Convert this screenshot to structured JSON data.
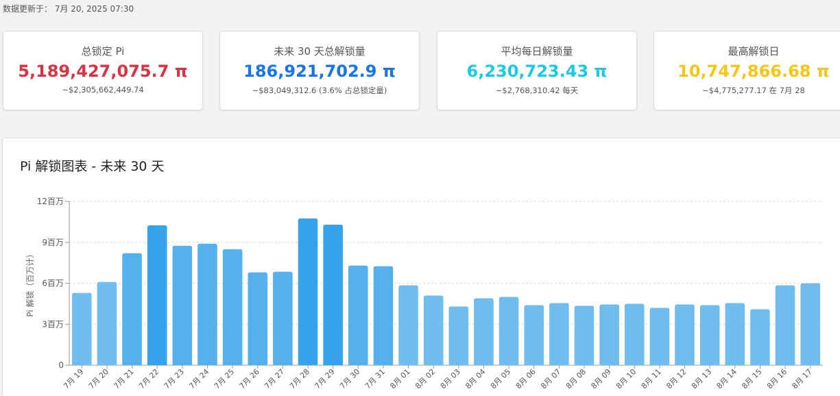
{
  "updated_text": "数据更新于： 7月 20, 2025 07:30",
  "cards": [
    {
      "label": "总锁定 Pi",
      "value": "5,189,427,075.7 π",
      "sub": "~$2,305,662,449.74",
      "color": "#d63344"
    },
    {
      "label": "未来 30 天总解锁量",
      "value": "186,921,702.9 π",
      "sub": "~$83,049,312.6 (3.6% 占总锁定量)",
      "color": "#1a73e8"
    },
    {
      "label": "平均每日解锁量",
      "value": "6,230,723.43 π",
      "sub": "~$2,768,310.42 每天",
      "color": "#1ec8e0"
    },
    {
      "label": "最高解锁日",
      "value": "10,747,866.68 π",
      "sub": "~$4,775,277.17 在 7月 28",
      "color": "#f5c518"
    }
  ],
  "chart_panel_title": "Pi 解锁图表 - 未来 30 天",
  "chart_data": {
    "type": "bar",
    "title": "Pi 解锁图表 - 未来 30 天",
    "ylabel": "Pi 解锁（百万计）",
    "xlabel": "",
    "ylim": [
      0,
      12
    ],
    "yticks": [
      0,
      3,
      6,
      9,
      12
    ],
    "ytick_labels": [
      "0",
      "3百万",
      "6百万",
      "9百万",
      "12百万"
    ],
    "grid": true,
    "categories": [
      "7月 19",
      "7月 20",
      "7月 21",
      "7月 22",
      "7月 23",
      "7月 24",
      "7月 25",
      "7月 26",
      "7月 27",
      "7月 28",
      "7月 29",
      "7月 30",
      "7月 31",
      "8月 01",
      "8月 02",
      "8月 03",
      "8月 04",
      "8月 05",
      "8月 06",
      "8月 07",
      "8月 08",
      "8月 09",
      "8月 10",
      "8月 11",
      "8月 12",
      "8月 13",
      "8月 14",
      "8月 15",
      "8月 16",
      "8月 17"
    ],
    "values": [
      5.3,
      6.1,
      8.2,
      10.25,
      8.75,
      8.9,
      8.5,
      6.8,
      6.85,
      10.75,
      10.3,
      7.3,
      7.25,
      5.85,
      5.1,
      4.3,
      4.9,
      5.0,
      4.4,
      4.55,
      4.35,
      4.45,
      4.5,
      4.2,
      4.45,
      4.4,
      4.55,
      4.1,
      5.85,
      6.0
    ],
    "colors": {
      "high": "#35a3ea",
      "mid": "#55b1ec",
      "low": "#6fbdef"
    }
  }
}
